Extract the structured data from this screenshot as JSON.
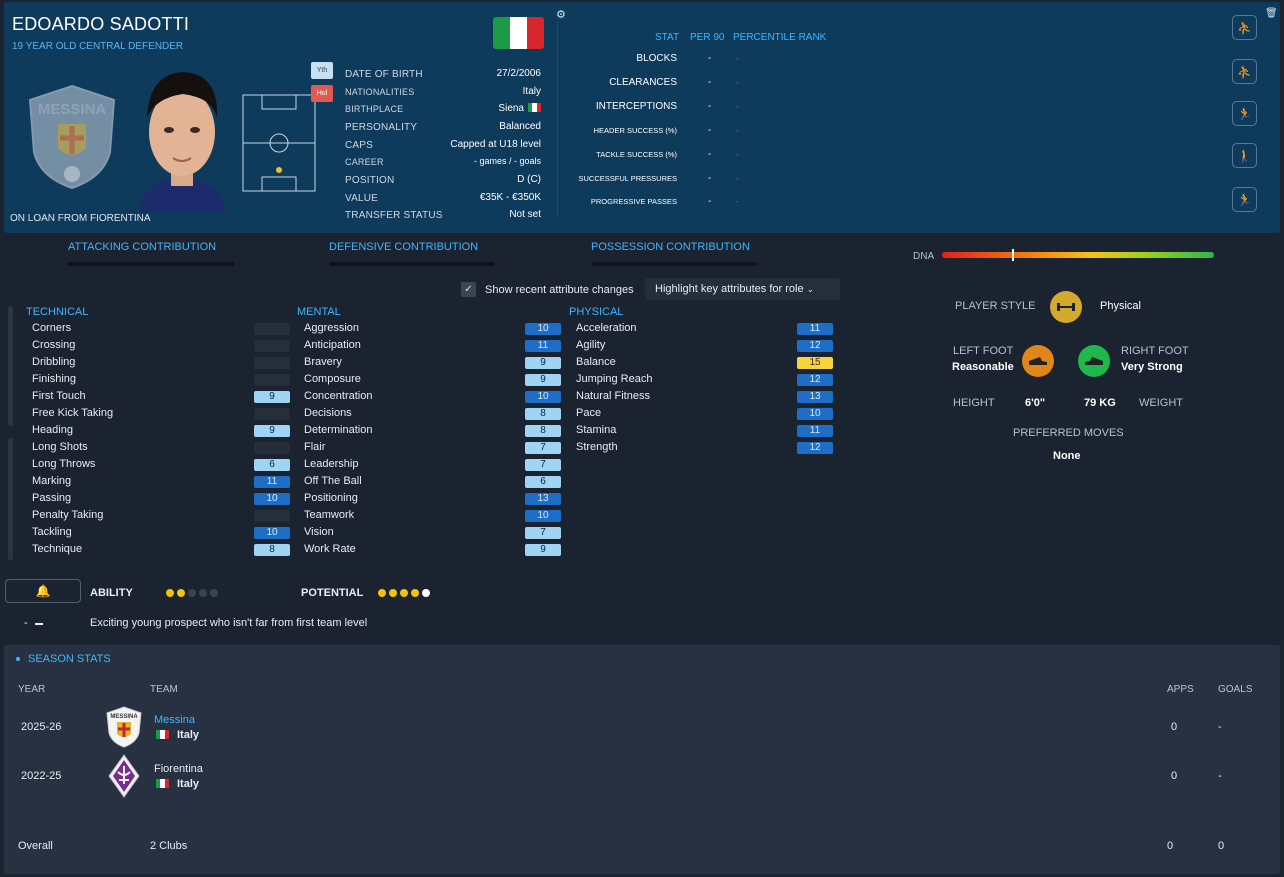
{
  "player": {
    "name": "EDOARDO SADOTTI",
    "subtitle": "19 YEAR OLD  CENTRAL DEFENDER",
    "on_loan": "ON LOAN FROM FIORENTINA",
    "badge_yth": "Yth",
    "badge_hol": "Hol"
  },
  "info": {
    "rows": [
      {
        "label": "DATE OF BIRTH",
        "value": "27/2/2006"
      },
      {
        "label": "NATIONALITIES",
        "value": "Italy"
      },
      {
        "label": "BIRTHPLACE",
        "value": "Siena"
      },
      {
        "label": "PERSONALITY",
        "value": "Balanced"
      },
      {
        "label": "CAPS",
        "value": "Capped at U18 level"
      },
      {
        "label": "CAREER",
        "value": "- games /     -  goals"
      },
      {
        "label": "POSITION",
        "value": "D (C)"
      },
      {
        "label": "VALUE",
        "value": "€35K - €350K"
      },
      {
        "label": "TRANSFER STATUS",
        "value": "Not set"
      }
    ]
  },
  "stats_table": {
    "header_stat": "STAT",
    "header_per90": "PER 90",
    "header_rank": "PERCENTILE RANK",
    "rows": [
      {
        "name": "BLOCKS",
        "per90": "-",
        "rank": "-"
      },
      {
        "name": "CLEARANCES",
        "per90": "-",
        "rank": "-"
      },
      {
        "name": "INTERCEPTIONS",
        "per90": "-",
        "rank": "-"
      },
      {
        "name": "HEADER SUCCESS (%)",
        "per90": "-",
        "rank": "-"
      },
      {
        "name": "TACKLE SUCCESS (%)",
        "per90": "-",
        "rank": "-"
      },
      {
        "name": "SUCCESSFUL PRESSURES",
        "per90": "-",
        "rank": "-"
      },
      {
        "name": "PROGRESSIVE PASSES",
        "per90": "-",
        "rank": "-"
      }
    ]
  },
  "contributions": {
    "attacking": "ATTACKING CONTRIBUTION",
    "defensive": "DEFENSIVE CONTRIBUTION",
    "possession": "POSSESSION CONTRIBUTION"
  },
  "dna": {
    "label": "DNA"
  },
  "controls": {
    "show_changes": "Show recent attribute changes",
    "highlight": "Highlight key attributes for role"
  },
  "technical": {
    "title": "TECHNICAL",
    "items": [
      {
        "name": "Corners",
        "value": "",
        "style": "em"
      },
      {
        "name": "Crossing",
        "value": "",
        "style": "em"
      },
      {
        "name": "Dribbling",
        "value": "",
        "style": "em"
      },
      {
        "name": "Finishing",
        "value": "",
        "style": "em"
      },
      {
        "name": "First Touch",
        "value": "9",
        "style": "lo"
      },
      {
        "name": "Free Kick Taking",
        "value": "",
        "style": "em"
      },
      {
        "name": "Heading",
        "value": "9",
        "style": "lo"
      },
      {
        "name": "Long Shots",
        "value": "",
        "style": "em"
      },
      {
        "name": "Long Throws",
        "value": "6",
        "style": "lo"
      },
      {
        "name": "Marking",
        "value": "11",
        "style": "hi"
      },
      {
        "name": "Passing",
        "value": "10",
        "style": "hi"
      },
      {
        "name": "Penalty Taking",
        "value": "",
        "style": "em"
      },
      {
        "name": "Tackling",
        "value": "10",
        "style": "hi"
      },
      {
        "name": "Technique",
        "value": "8",
        "style": "lo"
      }
    ]
  },
  "mental": {
    "title": "MENTAL",
    "items": [
      {
        "name": "Aggression",
        "value": "10",
        "style": "hi"
      },
      {
        "name": "Anticipation",
        "value": "11",
        "style": "hi"
      },
      {
        "name": "Bravery",
        "value": "9",
        "style": "lo"
      },
      {
        "name": "Composure",
        "value": "9",
        "style": "lo"
      },
      {
        "name": "Concentration",
        "value": "10",
        "style": "hi"
      },
      {
        "name": "Decisions",
        "value": "8",
        "style": "lo"
      },
      {
        "name": "Determination",
        "value": "8",
        "style": "lo"
      },
      {
        "name": "Flair",
        "value": "7",
        "style": "lo"
      },
      {
        "name": "Leadership",
        "value": "7",
        "style": "lo"
      },
      {
        "name": "Off The Ball",
        "value": "6",
        "style": "lo"
      },
      {
        "name": "Positioning",
        "value": "13",
        "style": "hi"
      },
      {
        "name": "Teamwork",
        "value": "10",
        "style": "hi"
      },
      {
        "name": "Vision",
        "value": "7",
        "style": "lo"
      },
      {
        "name": "Work Rate",
        "value": "9",
        "style": "lo"
      }
    ]
  },
  "physical": {
    "title": "PHYSICAL",
    "items": [
      {
        "name": "Acceleration",
        "value": "11",
        "style": "hi"
      },
      {
        "name": "Agility",
        "value": "12",
        "style": "hi"
      },
      {
        "name": "Balance",
        "value": "15",
        "style": "y"
      },
      {
        "name": "Jumping Reach",
        "value": "12",
        "style": "hi"
      },
      {
        "name": "Natural Fitness",
        "value": "13",
        "style": "hi"
      },
      {
        "name": "Pace",
        "value": "10",
        "style": "hi"
      },
      {
        "name": "Stamina",
        "value": "11",
        "style": "hi"
      },
      {
        "name": "Strength",
        "value": "12",
        "style": "hi"
      }
    ]
  },
  "profile": {
    "player_style_label": "PLAYER STYLE",
    "player_style_value": "Physical",
    "left_foot_label": "LEFT FOOT",
    "left_foot_value": "Reasonable",
    "right_foot_label": "RIGHT FOOT",
    "right_foot_value": "Very Strong",
    "height_label": "HEIGHT",
    "height_value": "6'0\"",
    "weight_value": "79 KG",
    "weight_label": "WEIGHT",
    "preferred_moves_label": "PREFERRED MOVES",
    "preferred_moves_value": "None"
  },
  "ability": {
    "ability_label": "ABILITY",
    "ability_filled": 2,
    "potential_label": "POTENTIAL",
    "potential_filled": 4,
    "dash": "-",
    "description": "Exciting young prospect who isn't far from first team level"
  },
  "season": {
    "title": "SEASON STATS",
    "col_year": "YEAR",
    "col_team": "TEAM",
    "col_apps": "APPS",
    "col_goals": "GOALS",
    "rows": [
      {
        "year": "2025-26",
        "team": "Messina",
        "country": "Italy",
        "apps": "0",
        "goals": "-"
      },
      {
        "year": "2022-25",
        "team": "Fiorentina",
        "country": "Italy",
        "apps": "0",
        "goals": "-"
      }
    ],
    "overall_label": "Overall",
    "overall_clubs": "2 Clubs",
    "overall_apps": "0",
    "overall_goals": "0"
  },
  "crest_texts": {
    "messina_big": "MESSINA",
    "messina_small": "MESSINA"
  },
  "colors": {
    "accent": "#3fb6ff",
    "header_bg": "#0e3a5c",
    "attr_high": "#1e6ec8",
    "attr_low": "#9fd4f4",
    "attr_top": "#f7d53a"
  }
}
